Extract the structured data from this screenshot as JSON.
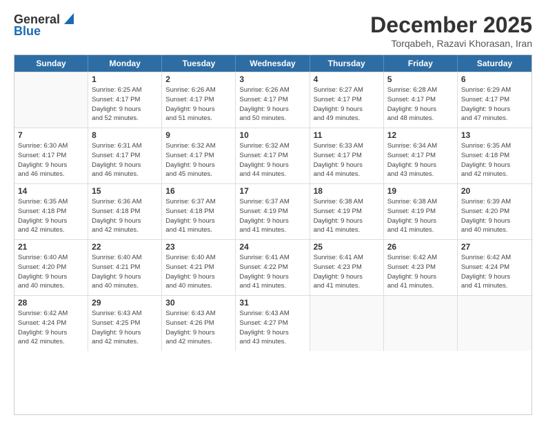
{
  "header": {
    "logo_general": "General",
    "logo_blue": "Blue",
    "title": "December 2025",
    "subtitle": "Torqabeh, Razavi Khorasan, Iran"
  },
  "calendar": {
    "weekdays": [
      "Sunday",
      "Monday",
      "Tuesday",
      "Wednesday",
      "Thursday",
      "Friday",
      "Saturday"
    ],
    "rows": [
      [
        {
          "day": "",
          "info": ""
        },
        {
          "day": "1",
          "info": "Sunrise: 6:25 AM\nSunset: 4:17 PM\nDaylight: 9 hours\nand 52 minutes."
        },
        {
          "day": "2",
          "info": "Sunrise: 6:26 AM\nSunset: 4:17 PM\nDaylight: 9 hours\nand 51 minutes."
        },
        {
          "day": "3",
          "info": "Sunrise: 6:26 AM\nSunset: 4:17 PM\nDaylight: 9 hours\nand 50 minutes."
        },
        {
          "day": "4",
          "info": "Sunrise: 6:27 AM\nSunset: 4:17 PM\nDaylight: 9 hours\nand 49 minutes."
        },
        {
          "day": "5",
          "info": "Sunrise: 6:28 AM\nSunset: 4:17 PM\nDaylight: 9 hours\nand 48 minutes."
        },
        {
          "day": "6",
          "info": "Sunrise: 6:29 AM\nSunset: 4:17 PM\nDaylight: 9 hours\nand 47 minutes."
        }
      ],
      [
        {
          "day": "7",
          "info": "Sunrise: 6:30 AM\nSunset: 4:17 PM\nDaylight: 9 hours\nand 46 minutes."
        },
        {
          "day": "8",
          "info": "Sunrise: 6:31 AM\nSunset: 4:17 PM\nDaylight: 9 hours\nand 46 minutes."
        },
        {
          "day": "9",
          "info": "Sunrise: 6:32 AM\nSunset: 4:17 PM\nDaylight: 9 hours\nand 45 minutes."
        },
        {
          "day": "10",
          "info": "Sunrise: 6:32 AM\nSunset: 4:17 PM\nDaylight: 9 hours\nand 44 minutes."
        },
        {
          "day": "11",
          "info": "Sunrise: 6:33 AM\nSunset: 4:17 PM\nDaylight: 9 hours\nand 44 minutes."
        },
        {
          "day": "12",
          "info": "Sunrise: 6:34 AM\nSunset: 4:17 PM\nDaylight: 9 hours\nand 43 minutes."
        },
        {
          "day": "13",
          "info": "Sunrise: 6:35 AM\nSunset: 4:18 PM\nDaylight: 9 hours\nand 42 minutes."
        }
      ],
      [
        {
          "day": "14",
          "info": "Sunrise: 6:35 AM\nSunset: 4:18 PM\nDaylight: 9 hours\nand 42 minutes."
        },
        {
          "day": "15",
          "info": "Sunrise: 6:36 AM\nSunset: 4:18 PM\nDaylight: 9 hours\nand 42 minutes."
        },
        {
          "day": "16",
          "info": "Sunrise: 6:37 AM\nSunset: 4:18 PM\nDaylight: 9 hours\nand 41 minutes."
        },
        {
          "day": "17",
          "info": "Sunrise: 6:37 AM\nSunset: 4:19 PM\nDaylight: 9 hours\nand 41 minutes."
        },
        {
          "day": "18",
          "info": "Sunrise: 6:38 AM\nSunset: 4:19 PM\nDaylight: 9 hours\nand 41 minutes."
        },
        {
          "day": "19",
          "info": "Sunrise: 6:38 AM\nSunset: 4:19 PM\nDaylight: 9 hours\nand 41 minutes."
        },
        {
          "day": "20",
          "info": "Sunrise: 6:39 AM\nSunset: 4:20 PM\nDaylight: 9 hours\nand 40 minutes."
        }
      ],
      [
        {
          "day": "21",
          "info": "Sunrise: 6:40 AM\nSunset: 4:20 PM\nDaylight: 9 hours\nand 40 minutes."
        },
        {
          "day": "22",
          "info": "Sunrise: 6:40 AM\nSunset: 4:21 PM\nDaylight: 9 hours\nand 40 minutes."
        },
        {
          "day": "23",
          "info": "Sunrise: 6:40 AM\nSunset: 4:21 PM\nDaylight: 9 hours\nand 40 minutes."
        },
        {
          "day": "24",
          "info": "Sunrise: 6:41 AM\nSunset: 4:22 PM\nDaylight: 9 hours\nand 41 minutes."
        },
        {
          "day": "25",
          "info": "Sunrise: 6:41 AM\nSunset: 4:23 PM\nDaylight: 9 hours\nand 41 minutes."
        },
        {
          "day": "26",
          "info": "Sunrise: 6:42 AM\nSunset: 4:23 PM\nDaylight: 9 hours\nand 41 minutes."
        },
        {
          "day": "27",
          "info": "Sunrise: 6:42 AM\nSunset: 4:24 PM\nDaylight: 9 hours\nand 41 minutes."
        }
      ],
      [
        {
          "day": "28",
          "info": "Sunrise: 6:42 AM\nSunset: 4:24 PM\nDaylight: 9 hours\nand 42 minutes."
        },
        {
          "day": "29",
          "info": "Sunrise: 6:43 AM\nSunset: 4:25 PM\nDaylight: 9 hours\nand 42 minutes."
        },
        {
          "day": "30",
          "info": "Sunrise: 6:43 AM\nSunset: 4:26 PM\nDaylight: 9 hours\nand 42 minutes."
        },
        {
          "day": "31",
          "info": "Sunrise: 6:43 AM\nSunset: 4:27 PM\nDaylight: 9 hours\nand 43 minutes."
        },
        {
          "day": "",
          "info": ""
        },
        {
          "day": "",
          "info": ""
        },
        {
          "day": "",
          "info": ""
        }
      ]
    ]
  }
}
